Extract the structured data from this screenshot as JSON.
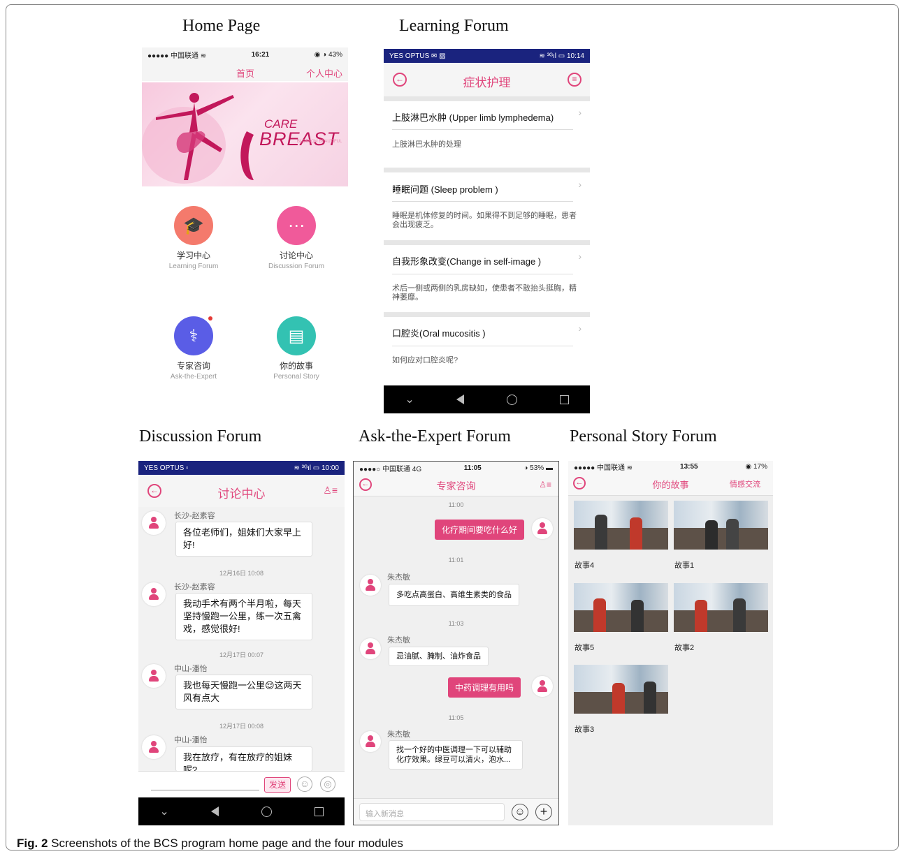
{
  "panel_titles": {
    "home": "Home Page",
    "learning": "Learning Forum",
    "discussion": "Discussion Forum",
    "expert": "Ask-the-Expert Forum",
    "story": "Personal Story Forum"
  },
  "caption": {
    "label": "Fig. 2",
    "text": "Screenshots of the BCS program home page and the four modules"
  },
  "colors": {
    "accent": "#e0457b",
    "learning_icon": "#f47a6c",
    "discussion_icon": "#f05a9a",
    "expert_icon": "#5a5de6",
    "story_icon": "#33c2b2"
  },
  "home": {
    "status_left": "●●●●● 中国联通 ≋",
    "status_time": "16:21",
    "status_right": "◉ ◑ 43%",
    "tab_home": "首页",
    "tab_profile": "个人中心",
    "banner_care": "CARE",
    "banner_breast": "BREAST",
    "banner_sub": "BLOSSOM BEAUTIFUL",
    "tiles": [
      {
        "zh": "学习中心",
        "en": "Learning Forum",
        "icon": "graduation-cap-icon",
        "glyph": "🎓"
      },
      {
        "zh": "讨论中心",
        "en": "Discussion Forum",
        "icon": "chat-icon",
        "glyph": "⋯"
      },
      {
        "zh": "专家咨询",
        "en": "Ask-the-Expert",
        "icon": "doctor-icon",
        "glyph": "⚕"
      },
      {
        "zh": "你的故事",
        "en": "Personal Story",
        "icon": "book-icon",
        "glyph": "▤"
      }
    ]
  },
  "learning": {
    "status_left": "YES OPTUS ✉ ▨",
    "status_right": "≋ ³ᴳıl ▭ 10:14",
    "title": "症状护理",
    "back_icon": "←",
    "menu_icon": "≡",
    "items": [
      {
        "head": "上肢淋巴水肿 (Upper limb lymphedema)",
        "body": "上肢淋巴水肿的处理"
      },
      {
        "head": "睡眠问题 (Sleep problem )",
        "body": "睡眠是机体修复的时间。如果得不到足够的睡眠，患者会出现疲乏。"
      },
      {
        "head": "自我形象改变(Change in self-image )",
        "body": "术后一侧或两侧的乳房缺如，使患者不敢抬头挺胸，精神萎靡。"
      },
      {
        "head": "口腔炎(Oral mucositis )",
        "body": "如何应对口腔炎呢?"
      }
    ],
    "chevron": "›",
    "nav_down": "⌄"
  },
  "discussion": {
    "status_left": "YES OPTUS ▫",
    "status_right": "≋ ³ᴳıl ▭ 10:00",
    "title": "讨论中心",
    "back_icon": "←",
    "members_icon": "♙≡",
    "messages": [
      {
        "user": "长沙-赵素容",
        "text": "各位老师们，姐妹们大家早上好!"
      },
      {
        "time": "12月16日 10:08",
        "user": "长沙-赵素容",
        "text": "我动手术有两个半月啦，每天坚持慢跑一公里，练一次五禽戏，感觉很好!"
      },
      {
        "time": "12月17日 00:07",
        "user": "中山-潘怡",
        "text": "我也每天慢跑一公里😌这两天风有点大"
      },
      {
        "time": "12月17日 00:08",
        "user": "中山-潘怡",
        "text": "我在放疗，有在放疗的姐妹呢?"
      }
    ],
    "send_label": "发送",
    "emoji_icon": "☺",
    "image_icon": "◎",
    "nav_down": "⌄"
  },
  "expert": {
    "status_left": "●●●●○ 中国联通 4G",
    "status_time": "11:05",
    "status_right": "◑ 53% ▬",
    "title": "专家咨询",
    "back_icon": "←",
    "members_icon": "♙≡",
    "t1": "11:00",
    "q1": "化疗期间要吃什么好",
    "t2": "11:01",
    "expert_name": "朱杰敏",
    "a1": "多吃点高蛋白、高维生素类的食品",
    "t3": "11:03",
    "a2": "忌油腻、腌制、油炸食品",
    "q2": "中药调理有用吗",
    "t4": "11:05",
    "a3": "找一个好的中医调理一下可以辅助化疗效果。绿豆可以清火，泡水...",
    "input_placeholder": "输入新消息",
    "emoji_icon": "☺",
    "plus_icon": "+"
  },
  "story": {
    "status_left": "●●●●● 中国联通 ≋",
    "status_time": "13:55",
    "status_right": "◉ 17%",
    "title": "你的故事",
    "back_icon": "←",
    "action": "情感交流",
    "stories": [
      "故事4",
      "故事1",
      "故事5",
      "故事2",
      "故事3"
    ]
  }
}
